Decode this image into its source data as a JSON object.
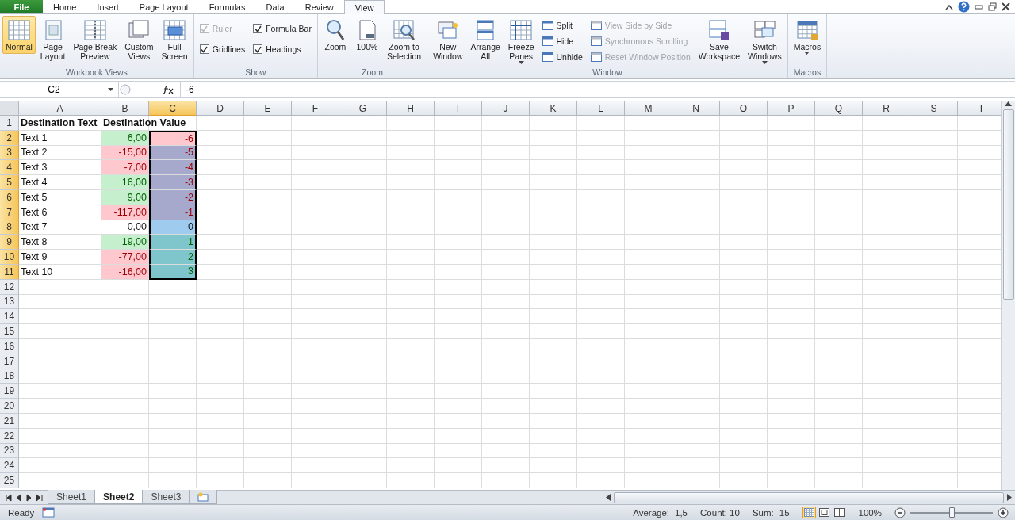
{
  "ribbon_tabs": [
    {
      "label": "File",
      "kind": "file",
      "selected": false
    },
    {
      "label": "Home",
      "kind": "tab",
      "selected": false
    },
    {
      "label": "Insert",
      "kind": "tab",
      "selected": false
    },
    {
      "label": "Page Layout",
      "kind": "tab",
      "selected": false
    },
    {
      "label": "Formulas",
      "kind": "tab",
      "selected": false
    },
    {
      "label": "Data",
      "kind": "tab",
      "selected": false
    },
    {
      "label": "Review",
      "kind": "tab",
      "selected": false
    },
    {
      "label": "View",
      "kind": "tab",
      "selected": true
    }
  ],
  "ribbon_groups": [
    {
      "label": "Workbook Views",
      "items": [
        {
          "kind": "large",
          "lines": [
            "Normal"
          ],
          "selected": true
        },
        {
          "kind": "large",
          "lines": [
            "Page",
            "Layout"
          ],
          "selected": false
        },
        {
          "kind": "large",
          "lines": [
            "Page Break",
            "Preview"
          ],
          "selected": false
        },
        {
          "kind": "large",
          "lines": [
            "Custom",
            "Views"
          ]
        },
        {
          "kind": "large",
          "lines": [
            "Full",
            "Screen"
          ]
        }
      ]
    },
    {
      "label": "Show",
      "items": [
        {
          "kind": "stack",
          "items": [
            {
              "kind": "check",
              "label": "Ruler",
              "checked": true,
              "disabled": true
            },
            {
              "kind": "check",
              "label": "Gridlines",
              "checked": true,
              "disabled": false
            }
          ]
        },
        {
          "kind": "stack",
          "items": [
            {
              "kind": "check",
              "label": "Formula Bar",
              "checked": true,
              "disabled": false
            },
            {
              "kind": "check",
              "label": "Headings",
              "checked": true,
              "disabled": false
            }
          ]
        }
      ]
    },
    {
      "label": "Zoom",
      "items": [
        {
          "kind": "large",
          "lines": [
            "Zoom"
          ]
        },
        {
          "kind": "large",
          "lines": [
            "100%"
          ]
        },
        {
          "kind": "large",
          "lines": [
            "Zoom to",
            "Selection"
          ]
        }
      ]
    },
    {
      "label": "Window",
      "items": [
        {
          "kind": "large",
          "lines": [
            "New",
            "Window"
          ]
        },
        {
          "kind": "large",
          "lines": [
            "Arrange",
            "All"
          ]
        },
        {
          "kind": "large",
          "lines": [
            "Freeze",
            "Panes"
          ],
          "dropdown": true
        },
        {
          "kind": "stack",
          "items": [
            {
              "kind": "small",
              "label": "Split",
              "disabled": false
            },
            {
              "kind": "small",
              "label": "Hide",
              "disabled": false
            },
            {
              "kind": "small",
              "label": "Unhide",
              "disabled": false
            }
          ]
        },
        {
          "kind": "stack",
          "items": [
            {
              "kind": "small",
              "label": "View Side by Side",
              "disabled": true
            },
            {
              "kind": "small",
              "label": "Synchronous Scrolling",
              "disabled": true
            },
            {
              "kind": "small",
              "label": "Reset Window Position",
              "disabled": true
            }
          ]
        },
        {
          "kind": "large",
          "lines": [
            "Save",
            "Workspace"
          ]
        },
        {
          "kind": "large",
          "lines": [
            "Switch",
            "Windows"
          ],
          "dropdown": true
        }
      ]
    },
    {
      "label": "Macros",
      "items": [
        {
          "kind": "large",
          "lines": [
            "Macros"
          ],
          "dropdown": true
        }
      ]
    }
  ],
  "name_box": "C2",
  "formula": "-6",
  "columns": [
    {
      "label": "A",
      "selected": false
    },
    {
      "label": "B",
      "selected": false
    },
    {
      "label": "C",
      "selected": true
    },
    {
      "label": "D",
      "selected": false
    },
    {
      "label": "E",
      "selected": false
    },
    {
      "label": "F",
      "selected": false
    },
    {
      "label": "G",
      "selected": false
    },
    {
      "label": "H",
      "selected": false
    },
    {
      "label": "I",
      "selected": false
    },
    {
      "label": "J",
      "selected": false
    },
    {
      "label": "K",
      "selected": false
    },
    {
      "label": "L",
      "selected": false
    },
    {
      "label": "M",
      "selected": false
    },
    {
      "label": "N",
      "selected": false
    },
    {
      "label": "O",
      "selected": false
    },
    {
      "label": "P",
      "selected": false
    },
    {
      "label": "Q",
      "selected": false
    },
    {
      "label": "R",
      "selected": false
    },
    {
      "label": "S",
      "selected": false
    },
    {
      "label": "T",
      "selected": false
    }
  ],
  "rows": [
    {
      "number": "1",
      "selected": false,
      "cells": [
        {
          "text": "Destination Text",
          "bold": true
        },
        {
          "text": "Destination Value",
          "bold": true
        }
      ]
    },
    {
      "number": "2",
      "selected": true,
      "cells": [
        {
          "text": "Text 1"
        },
        {
          "text": "6,00",
          "color": "#c6efce",
          "kind": "positive"
        },
        {
          "text": "-6",
          "color": "#ffc7ce",
          "kind": "negative"
        }
      ]
    },
    {
      "number": "3",
      "selected": true,
      "cells": [
        {
          "text": "Text 2"
        },
        {
          "text": "-15,00",
          "color": "#ffc7ce",
          "kind": "negative"
        },
        {
          "text": "-5",
          "color": "#a6a8cc",
          "kind": "negative"
        }
      ]
    },
    {
      "number": "4",
      "selected": true,
      "cells": [
        {
          "text": "Text 3"
        },
        {
          "text": "-7,00",
          "color": "#ffc7ce",
          "kind": "negative"
        },
        {
          "text": "-4",
          "color": "#a6a8cc",
          "kind": "negative"
        }
      ]
    },
    {
      "number": "5",
      "selected": true,
      "cells": [
        {
          "text": "Text 4"
        },
        {
          "text": "16,00",
          "color": "#c6efce",
          "kind": "positive"
        },
        {
          "text": "-3",
          "color": "#a6a8cc",
          "kind": "negative"
        }
      ]
    },
    {
      "number": "6",
      "selected": true,
      "cells": [
        {
          "text": "Text 5"
        },
        {
          "text": "9,00",
          "color": "#c6efce",
          "kind": "positive"
        },
        {
          "text": "-2",
          "color": "#a6a8cc",
          "kind": "negative"
        }
      ]
    },
    {
      "number": "7",
      "selected": true,
      "cells": [
        {
          "text": "Text 6"
        },
        {
          "text": "-117,00",
          "color": "#ffc7ce",
          "kind": "negative"
        },
        {
          "text": "-1",
          "color": "#a6a8cc",
          "kind": "negative"
        }
      ]
    },
    {
      "number": "8",
      "selected": true,
      "cells": [
        {
          "text": "Text 7"
        },
        {
          "text": "0,00"
        },
        {
          "text": "0",
          "color": "#9fcbee"
        }
      ]
    },
    {
      "number": "9",
      "selected": true,
      "cells": [
        {
          "text": "Text 8"
        },
        {
          "text": "19,00",
          "color": "#c6efce",
          "kind": "positive"
        },
        {
          "text": "1",
          "color": "#7fc5cc",
          "kind": "positive"
        }
      ]
    },
    {
      "number": "10",
      "selected": true,
      "cells": [
        {
          "text": "Text 9"
        },
        {
          "text": "-77,00",
          "color": "#ffc7ce",
          "kind": "negative"
        },
        {
          "text": "2",
          "color": "#7fc5cc",
          "kind": "positive"
        }
      ]
    },
    {
      "number": "11",
      "selected": true,
      "cells": [
        {
          "text": "Text 10"
        },
        {
          "text": "-16,00",
          "color": "#ffc7ce",
          "kind": "negative"
        },
        {
          "text": "3",
          "color": "#7fc5cc",
          "kind": "positive"
        }
      ]
    },
    {
      "number": "12",
      "selected": false,
      "cells": []
    },
    {
      "number": "13",
      "selected": false,
      "cells": []
    },
    {
      "number": "14",
      "selected": false,
      "cells": []
    },
    {
      "number": "15",
      "selected": false,
      "cells": []
    },
    {
      "number": "16",
      "selected": false,
      "cells": []
    },
    {
      "number": "17",
      "selected": false,
      "cells": []
    },
    {
      "number": "18",
      "selected": false,
      "cells": []
    },
    {
      "number": "19",
      "selected": false,
      "cells": []
    },
    {
      "number": "20",
      "selected": false,
      "cells": []
    },
    {
      "number": "21",
      "selected": false,
      "cells": []
    },
    {
      "number": "22",
      "selected": false,
      "cells": []
    },
    {
      "number": "23",
      "selected": false,
      "cells": []
    },
    {
      "number": "24",
      "selected": false,
      "cells": []
    },
    {
      "number": "25",
      "selected": false,
      "cells": []
    }
  ],
  "sheets": [
    {
      "label": "Sheet1",
      "selected": false
    },
    {
      "label": "Sheet2",
      "selected": true
    },
    {
      "label": "Sheet3",
      "selected": false
    }
  ],
  "status": "Ready",
  "stats": [
    "Average: -1,5",
    "Count: 10",
    "Sum: -15"
  ],
  "view_buttons": [
    {
      "selected": true
    },
    {
      "selected": false
    },
    {
      "selected": false
    }
  ],
  "zoom": {
    "reading": "100%",
    "level": 0.5
  }
}
